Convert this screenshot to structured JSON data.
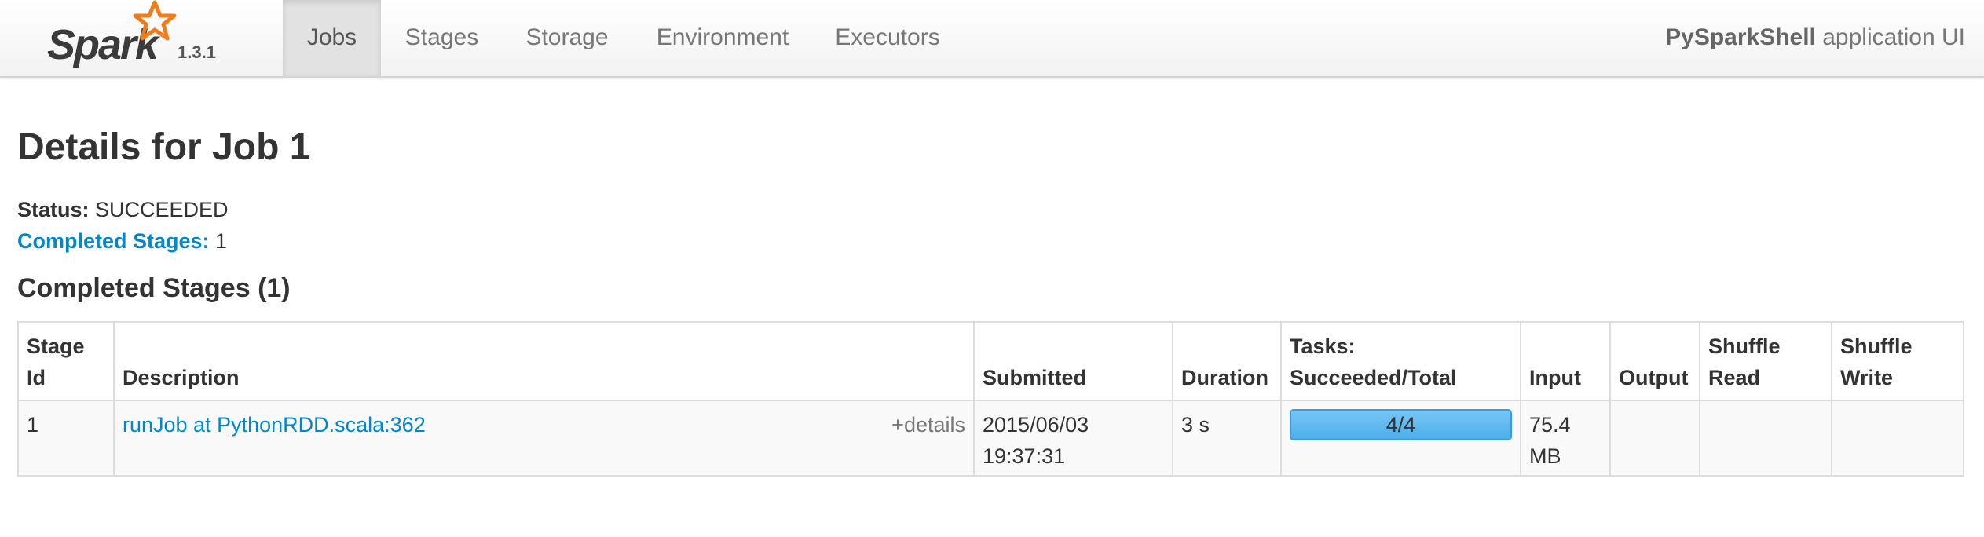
{
  "brand": {
    "name": "Spark",
    "version": "1.3.1",
    "accent_color": "#f07c1a"
  },
  "nav": {
    "tabs": [
      {
        "label": "Jobs",
        "active": true
      },
      {
        "label": "Stages",
        "active": false
      },
      {
        "label": "Storage",
        "active": false
      },
      {
        "label": "Environment",
        "active": false
      },
      {
        "label": "Executors",
        "active": false
      }
    ],
    "app_name": "PySparkShell",
    "app_suffix": " application UI"
  },
  "page": {
    "title": "Details for Job 1",
    "status_label": "Status:",
    "status_value": " SUCCEEDED",
    "completed_stages_label": "Completed Stages:",
    "completed_stages_value": " 1"
  },
  "completed_section": {
    "title": "Completed Stages (1)",
    "table": {
      "headers": {
        "stage_id": [
          "Stage",
          "Id"
        ],
        "description": "Description",
        "submitted": "Submitted",
        "duration": "Duration",
        "tasks": [
          "Tasks:",
          "Succeeded/Total"
        ],
        "input": "Input",
        "output": "Output",
        "shuffle_read": [
          "Shuffle",
          "Read"
        ],
        "shuffle_write": [
          "Shuffle",
          "Write"
        ]
      },
      "rows": [
        {
          "stage_id": "1",
          "description": "runJob at PythonRDD.scala:362",
          "details_link": "+details",
          "submitted_date": "2015/06/03",
          "submitted_time": "19:37:31",
          "duration": "3 s",
          "tasks_label": "4/4",
          "tasks_progress": 1.0,
          "input_value": "75.4",
          "input_unit": "MB",
          "output": "",
          "shuffle_read": "",
          "shuffle_write": ""
        }
      ]
    }
  },
  "colors": {
    "link": "#0088cc",
    "progress_fill": "#5bb8f0",
    "nav_active_bg": "#e2e2e2"
  }
}
